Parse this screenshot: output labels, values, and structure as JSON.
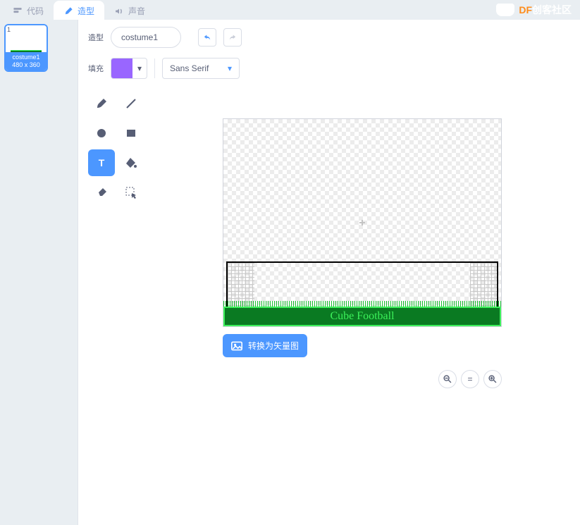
{
  "tabs": {
    "code": "代码",
    "costumes": "造型",
    "sounds": "声音",
    "active": "costumes"
  },
  "brand": {
    "prefix": "DF",
    "suffix": "创客社区"
  },
  "costume": {
    "label": "造型",
    "name": "costume1",
    "thumb_name": "costume1",
    "thumb_size": "480 x 360",
    "thumb_index": "1"
  },
  "fill": {
    "label": "填充",
    "color": "#9966ff"
  },
  "font": {
    "value": "Sans Serif"
  },
  "canvas": {
    "title_text": "Cube Football"
  },
  "actions": {
    "convert": "转换为矢量图"
  },
  "zoom": {
    "out": "−",
    "reset": "=",
    "in": "+"
  }
}
